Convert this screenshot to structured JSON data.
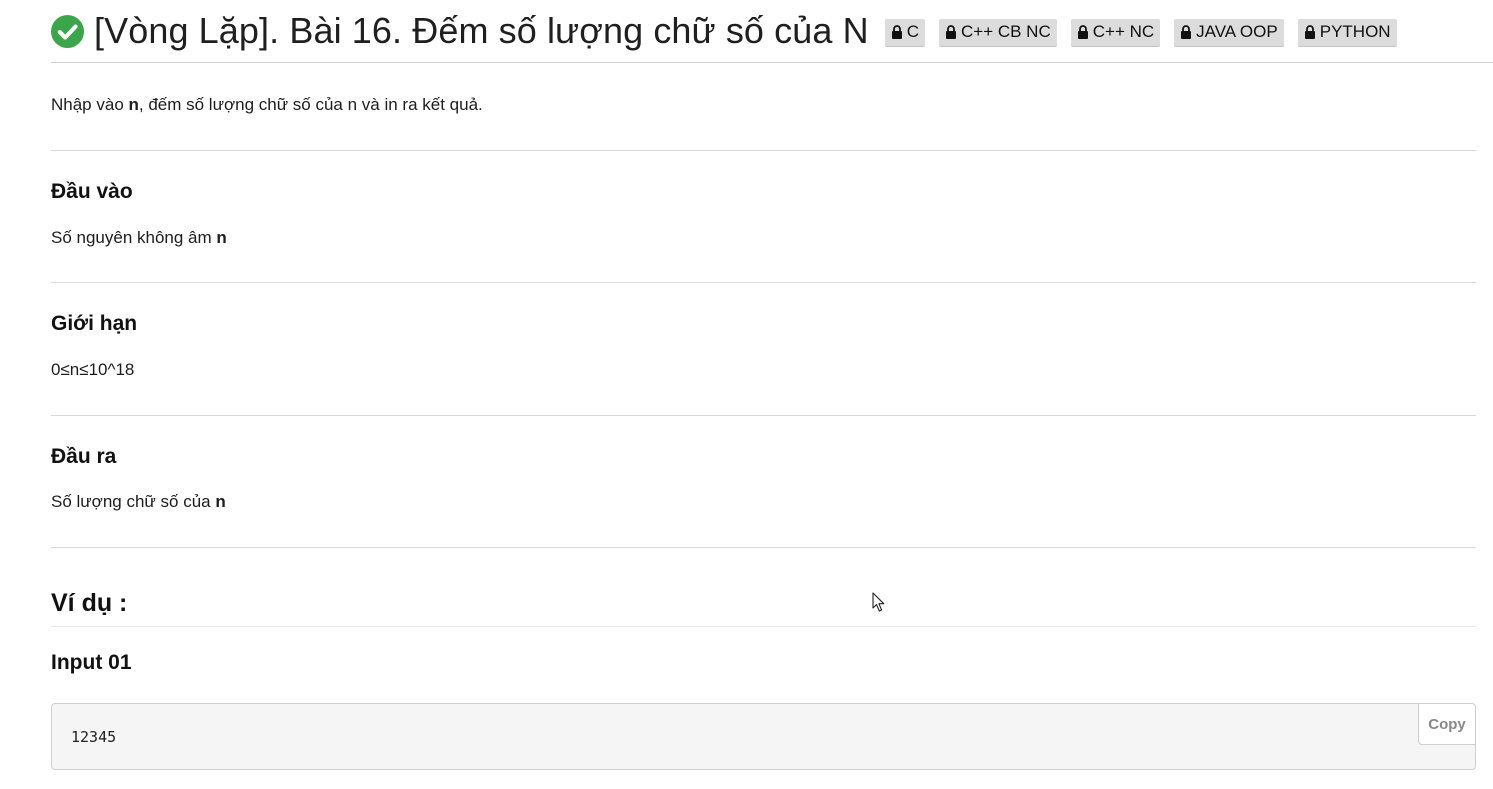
{
  "header": {
    "title": "[Vòng Lặp]. Bài 16. Đếm số lượng chữ số của N",
    "tags": [
      "C",
      "C++ CB NC",
      "C++ NC",
      "JAVA OOP",
      "PYTHON"
    ]
  },
  "description": {
    "prefix": "Nhập vào ",
    "var": "n",
    "suffix": ", đếm số lượng chữ số của n và in ra kết quả."
  },
  "sections": {
    "input": {
      "heading": "Đầu vào",
      "text": "Số nguyên không âm ",
      "var": "n"
    },
    "limits": {
      "heading": "Giới hạn",
      "text": "0≤n≤10^18"
    },
    "output": {
      "heading": "Đầu ra",
      "text": "Số lượng chữ số của ",
      "var": "n"
    }
  },
  "examples": {
    "heading": "Ví dụ :",
    "input_label": "Input 01",
    "input_value": "12345",
    "copy_label": "Copy"
  },
  "colors": {
    "check": "#3aa54a",
    "tag_bg": "#dcdcdc",
    "code_bg": "#f5f5f5"
  }
}
